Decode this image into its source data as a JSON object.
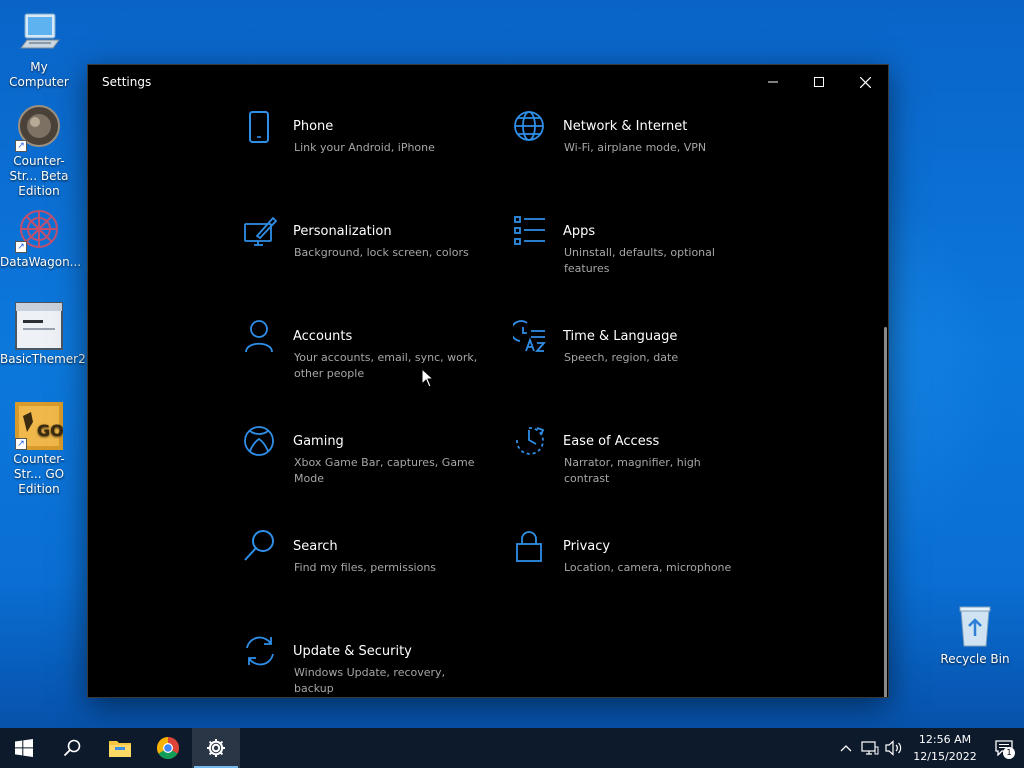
{
  "desktop": {
    "icons": [
      {
        "label": "My Computer",
        "icon": "computer-icon"
      },
      {
        "label": "Counter-Str... Beta Edition",
        "icon": "cs-beta-icon"
      },
      {
        "label": "DataWagon...",
        "icon": "datawagon-icon"
      },
      {
        "label": "BasicThemer2",
        "icon": "window-app-icon"
      },
      {
        "label": "Counter-Str... GO Edition",
        "icon": "csgo-icon"
      },
      {
        "label": "Recycle Bin",
        "icon": "recycle-bin-icon"
      }
    ]
  },
  "window": {
    "title": "Settings",
    "controls": [
      "minimize",
      "maximize",
      "close"
    ]
  },
  "settings": {
    "items": [
      {
        "name": "Phone",
        "desc": "Link your Android, iPhone",
        "icon": "phone-icon"
      },
      {
        "name": "Network & Internet",
        "desc": "Wi-Fi, airplane mode, VPN",
        "icon": "globe-icon"
      },
      {
        "name": "Personalization",
        "desc": "Background, lock screen, colors",
        "icon": "paint-icon"
      },
      {
        "name": "Apps",
        "desc": "Uninstall, defaults, optional features",
        "icon": "apps-list-icon"
      },
      {
        "name": "Accounts",
        "desc": "Your accounts, email, sync, work, other people",
        "icon": "person-icon"
      },
      {
        "name": "Time & Language",
        "desc": "Speech, region, date",
        "icon": "time-language-icon"
      },
      {
        "name": "Gaming",
        "desc": "Xbox Game Bar, captures, Game Mode",
        "icon": "xbox-icon"
      },
      {
        "name": "Ease of Access",
        "desc": "Narrator, magnifier, high contrast",
        "icon": "ease-access-icon"
      },
      {
        "name": "Search",
        "desc": "Find my files, permissions",
        "icon": "search-icon"
      },
      {
        "name": "Privacy",
        "desc": "Location, camera, microphone",
        "icon": "lock-icon"
      },
      {
        "name": "Update & Security",
        "desc": "Windows Update, recovery, backup",
        "icon": "update-icon"
      }
    ]
  },
  "taskbar": {
    "apps": [
      "start-icon",
      "search-icon",
      "file-explorer-icon",
      "chrome-icon",
      "settings-gear-icon"
    ],
    "tray": [
      "chevron-up-icon",
      "network-icon",
      "volume-icon"
    ],
    "time": "12:56 AM",
    "date": "12/15/2022",
    "notification_count": "1"
  },
  "colors": {
    "accent": "#2f8fe8",
    "window_bg": "#000000",
    "taskbar_bg": "#0d1a2b"
  }
}
